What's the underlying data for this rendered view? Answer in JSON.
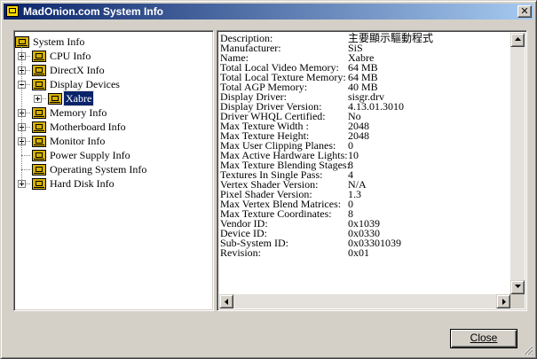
{
  "window": {
    "title": "MadOnion.com System Info"
  },
  "tree": {
    "root": "System Info",
    "items": [
      {
        "label": "CPU Info",
        "expander": "+"
      },
      {
        "label": "DirectX Info",
        "expander": "+"
      },
      {
        "label": "Display Devices",
        "expander": "-"
      },
      {
        "label": "Xabre",
        "expander": "+",
        "selected": true,
        "child": true
      },
      {
        "label": "Memory Info",
        "expander": "+"
      },
      {
        "label": "Motherboard Info",
        "expander": "+"
      },
      {
        "label": "Monitor Info",
        "expander": "+"
      },
      {
        "label": "Power Supply Info",
        "expander": ""
      },
      {
        "label": "Operating System Info",
        "expander": ""
      },
      {
        "label": "Hard Disk Info",
        "expander": "+"
      }
    ]
  },
  "properties": [
    {
      "key": "Description:",
      "value": "主要顯示驅動程式"
    },
    {
      "key": "Manufacturer:",
      "value": "SiS"
    },
    {
      "key": "Name:",
      "value": "Xabre"
    },
    {
      "key": "Total Local Video Memory:",
      "value": "64 MB"
    },
    {
      "key": "Total Local Texture Memory:",
      "value": "64 MB"
    },
    {
      "key": "Total AGP Memory:",
      "value": "40 MB"
    },
    {
      "key": "Display Driver:",
      "value": "sisgr.drv"
    },
    {
      "key": "Display Driver Version:",
      "value": "4.13.01.3010"
    },
    {
      "key": "Driver WHQL Certified:",
      "value": "No"
    },
    {
      "key": "Max Texture Width :",
      "value": "2048"
    },
    {
      "key": "Max Texture Height:",
      "value": "2048"
    },
    {
      "key": "Max User Clipping Planes:",
      "value": "0"
    },
    {
      "key": "Max Active Hardware Lights:",
      "value": "10"
    },
    {
      "key": "Max Texture Blending Stages:",
      "value": "8"
    },
    {
      "key": "Textures In Single Pass:",
      "value": "4"
    },
    {
      "key": "Vertex Shader Version:",
      "value": "N/A"
    },
    {
      "key": "Pixel Shader Version:",
      "value": "1.3"
    },
    {
      "key": "Max Vertex Blend Matrices:",
      "value": "0"
    },
    {
      "key": "Max Texture Coordinates:",
      "value": "8"
    },
    {
      "key": "Vendor ID:",
      "value": "0x1039"
    },
    {
      "key": "Device ID:",
      "value": "0x0330"
    },
    {
      "key": "Sub-System ID:",
      "value": "0x03301039"
    },
    {
      "key": "Revision:",
      "value": "0x01"
    }
  ],
  "buttons": {
    "close": "Close"
  },
  "colors": {
    "titlebar_start": "#0a246a",
    "titlebar_end": "#a6caf0",
    "selection": "#0a246a",
    "folder": "#d6b200"
  }
}
